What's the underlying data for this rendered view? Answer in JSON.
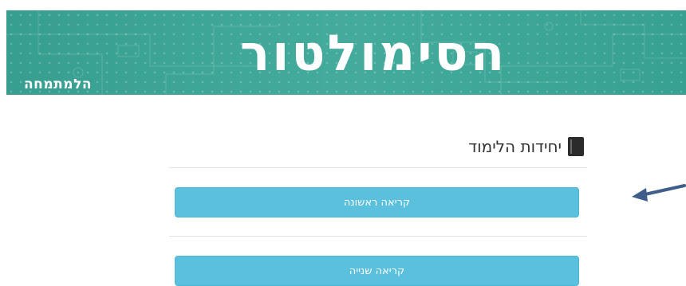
{
  "banner": {
    "title": "הסימולטור",
    "brand": "הלמתמחה"
  },
  "section": {
    "heading": "יחידות הלימוד",
    "icon": "book-icon",
    "units": [
      "קריאה ראשונה",
      "קריאה שנייה"
    ]
  },
  "colors": {
    "banner": "#3aa797",
    "button": "#5bc0de",
    "arrow": "#3f5f8a"
  }
}
